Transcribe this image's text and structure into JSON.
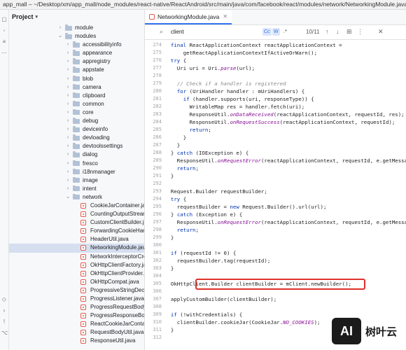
{
  "window": {
    "title": "app_mall – ~/Desktop/xm/app_mall/node_modules/react-native/ReactAndroid/src/main/java/com/facebook/react/modules/network/NetworkingModule.java"
  },
  "project_panel": {
    "title": "Project",
    "items": [
      {
        "label": "module",
        "type": "folder",
        "depth": 0,
        "expanded": false
      },
      {
        "label": "modules",
        "type": "folder",
        "depth": 0,
        "expanded": true
      },
      {
        "label": "accessibilityinfo",
        "type": "folder",
        "depth": 1,
        "expanded": false
      },
      {
        "label": "appearance",
        "type": "folder",
        "depth": 1,
        "expanded": false
      },
      {
        "label": "appregistry",
        "type": "folder",
        "depth": 1,
        "expanded": false
      },
      {
        "label": "appstate",
        "type": "folder",
        "depth": 1,
        "expanded": false
      },
      {
        "label": "blob",
        "type": "folder",
        "depth": 1,
        "expanded": false
      },
      {
        "label": "camera",
        "type": "folder",
        "depth": 1,
        "expanded": false
      },
      {
        "label": "clipboard",
        "type": "folder",
        "depth": 1,
        "expanded": false
      },
      {
        "label": "common",
        "type": "folder",
        "depth": 1,
        "expanded": false
      },
      {
        "label": "core",
        "type": "folder",
        "depth": 1,
        "expanded": false
      },
      {
        "label": "debug",
        "type": "folder",
        "depth": 1,
        "expanded": false
      },
      {
        "label": "deviceinfo",
        "type": "folder",
        "depth": 1,
        "expanded": false
      },
      {
        "label": "devloading",
        "type": "folder",
        "depth": 1,
        "expanded": false
      },
      {
        "label": "devtoolssettings",
        "type": "folder",
        "depth": 1,
        "expanded": false
      },
      {
        "label": "dialog",
        "type": "folder",
        "depth": 1,
        "expanded": false
      },
      {
        "label": "fresco",
        "type": "folder",
        "depth": 1,
        "expanded": false
      },
      {
        "label": "i18nmanager",
        "type": "folder",
        "depth": 1,
        "expanded": false
      },
      {
        "label": "image",
        "type": "folder",
        "depth": 1,
        "expanded": false
      },
      {
        "label": "intent",
        "type": "folder",
        "depth": 1,
        "expanded": false
      },
      {
        "label": "network",
        "type": "folder",
        "depth": 1,
        "expanded": true
      },
      {
        "label": "CookieJarContainer.java",
        "type": "file",
        "depth": 2
      },
      {
        "label": "CountingOutputStream.java",
        "type": "file",
        "depth": 2
      },
      {
        "label": "CustomClientBuilder.java",
        "type": "file",
        "depth": 2
      },
      {
        "label": "ForwardingCookieHandler",
        "type": "file",
        "depth": 2
      },
      {
        "label": "HeaderUtil.java",
        "type": "file",
        "depth": 2
      },
      {
        "label": "NetworkingModule.java",
        "type": "file",
        "depth": 2,
        "selected": true
      },
      {
        "label": "NetworkInterceptorCreator",
        "type": "file",
        "depth": 2
      },
      {
        "label": "OkHttpClientFactory.java",
        "type": "file",
        "depth": 2
      },
      {
        "label": "OkHttpClientProvider.java",
        "type": "file",
        "depth": 2
      },
      {
        "label": "OkHttpCompat.java",
        "type": "file",
        "depth": 2
      },
      {
        "label": "ProgressiveStringDecoder",
        "type": "file",
        "depth": 2
      },
      {
        "label": "ProgressListener.java",
        "type": "file",
        "depth": 2
      },
      {
        "label": "ProgressRequestBody.java",
        "type": "file",
        "depth": 2
      },
      {
        "label": "ProgressResponseBody.java",
        "type": "file",
        "depth": 2
      },
      {
        "label": "ReactCookieJarContainer",
        "type": "file",
        "depth": 2
      },
      {
        "label": "RequestBodyUtil.java",
        "type": "file",
        "depth": 2
      },
      {
        "label": "ResponseUtil.java",
        "type": "file",
        "depth": 2
      }
    ]
  },
  "editor": {
    "tab_label": "NetworkingModule.java",
    "search": {
      "query": "client",
      "match_case": "Cc",
      "words": "W",
      "regex": ".*",
      "count": "10/11"
    },
    "lines": [
      {
        "n": "274",
        "html": "  <span class=\"kw\">final</span> ReactApplicationContext reactApplicationContext ="
      },
      {
        "n": "275",
        "html": "      getReactApplicationContextIfActiveOrWarn();"
      },
      {
        "n": "276",
        "html": "  <span class=\"kw\">try</span> {"
      },
      {
        "n": "277",
        "html": "    Uri uri = Uri.<span class=\"st\">parse</span>(url);"
      },
      {
        "n": "278",
        "html": ""
      },
      {
        "n": "279",
        "html": "    <span class=\"cm\">// Check if a handler is registered</span>"
      },
      {
        "n": "280",
        "html": "    <span class=\"kw\">for</span> (UriHandler handler : mUriHandlers) {"
      },
      {
        "n": "281",
        "html": "      <span class=\"kw\">if</span> (handler.supports(uri, responseType)) {"
      },
      {
        "n": "282",
        "html": "        WritableMap res = handler.fetch(uri);"
      },
      {
        "n": "283",
        "html": "        ResponseUtil.<span class=\"st\">onDataReceived</span>(reactApplicationContext, requestId, res);"
      },
      {
        "n": "284",
        "html": "        ResponseUtil.<span class=\"st\">onRequestSuccess</span>(reactApplicationContext, requestId);"
      },
      {
        "n": "285",
        "html": "        <span class=\"kw\">return</span>;"
      },
      {
        "n": "286",
        "html": "      }"
      },
      {
        "n": "287",
        "html": "    }"
      },
      {
        "n": "288",
        "html": "  } <span class=\"kw\">catch</span> (IOException e) {"
      },
      {
        "n": "289",
        "html": "    ResponseUtil.<span class=\"st\">onRequestError</span>(reactApplicationContext, requestId, e.getMessage(), e);"
      },
      {
        "n": "290",
        "html": "    <span class=\"kw\">return</span>;"
      },
      {
        "n": "291",
        "html": "  }"
      },
      {
        "n": "292",
        "html": ""
      },
      {
        "n": "293",
        "html": "  Request.Builder requestBuilder;"
      },
      {
        "n": "294",
        "html": "  <span class=\"kw\">try</span> {"
      },
      {
        "n": "295",
        "html": "    requestBuilder = <span class=\"kw\">new</span> Request.Builder().url(url);"
      },
      {
        "n": "296",
        "html": "  } <span class=\"kw\">catch</span> (Exception e) {"
      },
      {
        "n": "297",
        "html": "    ResponseUtil.<span class=\"st\">onRequestError</span>(reactApplicationContext, requestId, e.getMessage(), null);"
      },
      {
        "n": "298",
        "html": "    <span class=\"kw\">return</span>;"
      },
      {
        "n": "299",
        "html": "  }"
      },
      {
        "n": "300",
        "html": ""
      },
      {
        "n": "301",
        "html": "  <span class=\"kw\">if</span> (requestId != 0) {"
      },
      {
        "n": "302",
        "html": "    requestBuilder.tag(requestId);"
      },
      {
        "n": "303",
        "html": "  }"
      },
      {
        "n": "304",
        "html": ""
      },
      {
        "n": "305",
        "html": "  OkHttpClient.Builder clientBuilder = mClient.newBuilder();"
      },
      {
        "n": "306",
        "html": ""
      },
      {
        "n": "307",
        "html": "  applyCustomBuilder(clientBuilder);"
      },
      {
        "n": "308",
        "html": ""
      },
      {
        "n": "309",
        "html": "  <span class=\"kw\">if</span> (!withCredentials) {"
      },
      {
        "n": "310",
        "html": "    clientBuilder.cookieJar(CookieJar.<span class=\"st\">NO_COOKIES</span>);"
      },
      {
        "n": "311",
        "html": "  }"
      },
      {
        "n": "312",
        "html": ""
      }
    ]
  },
  "watermark": {
    "logo": "AI",
    "text": "树叶云"
  }
}
